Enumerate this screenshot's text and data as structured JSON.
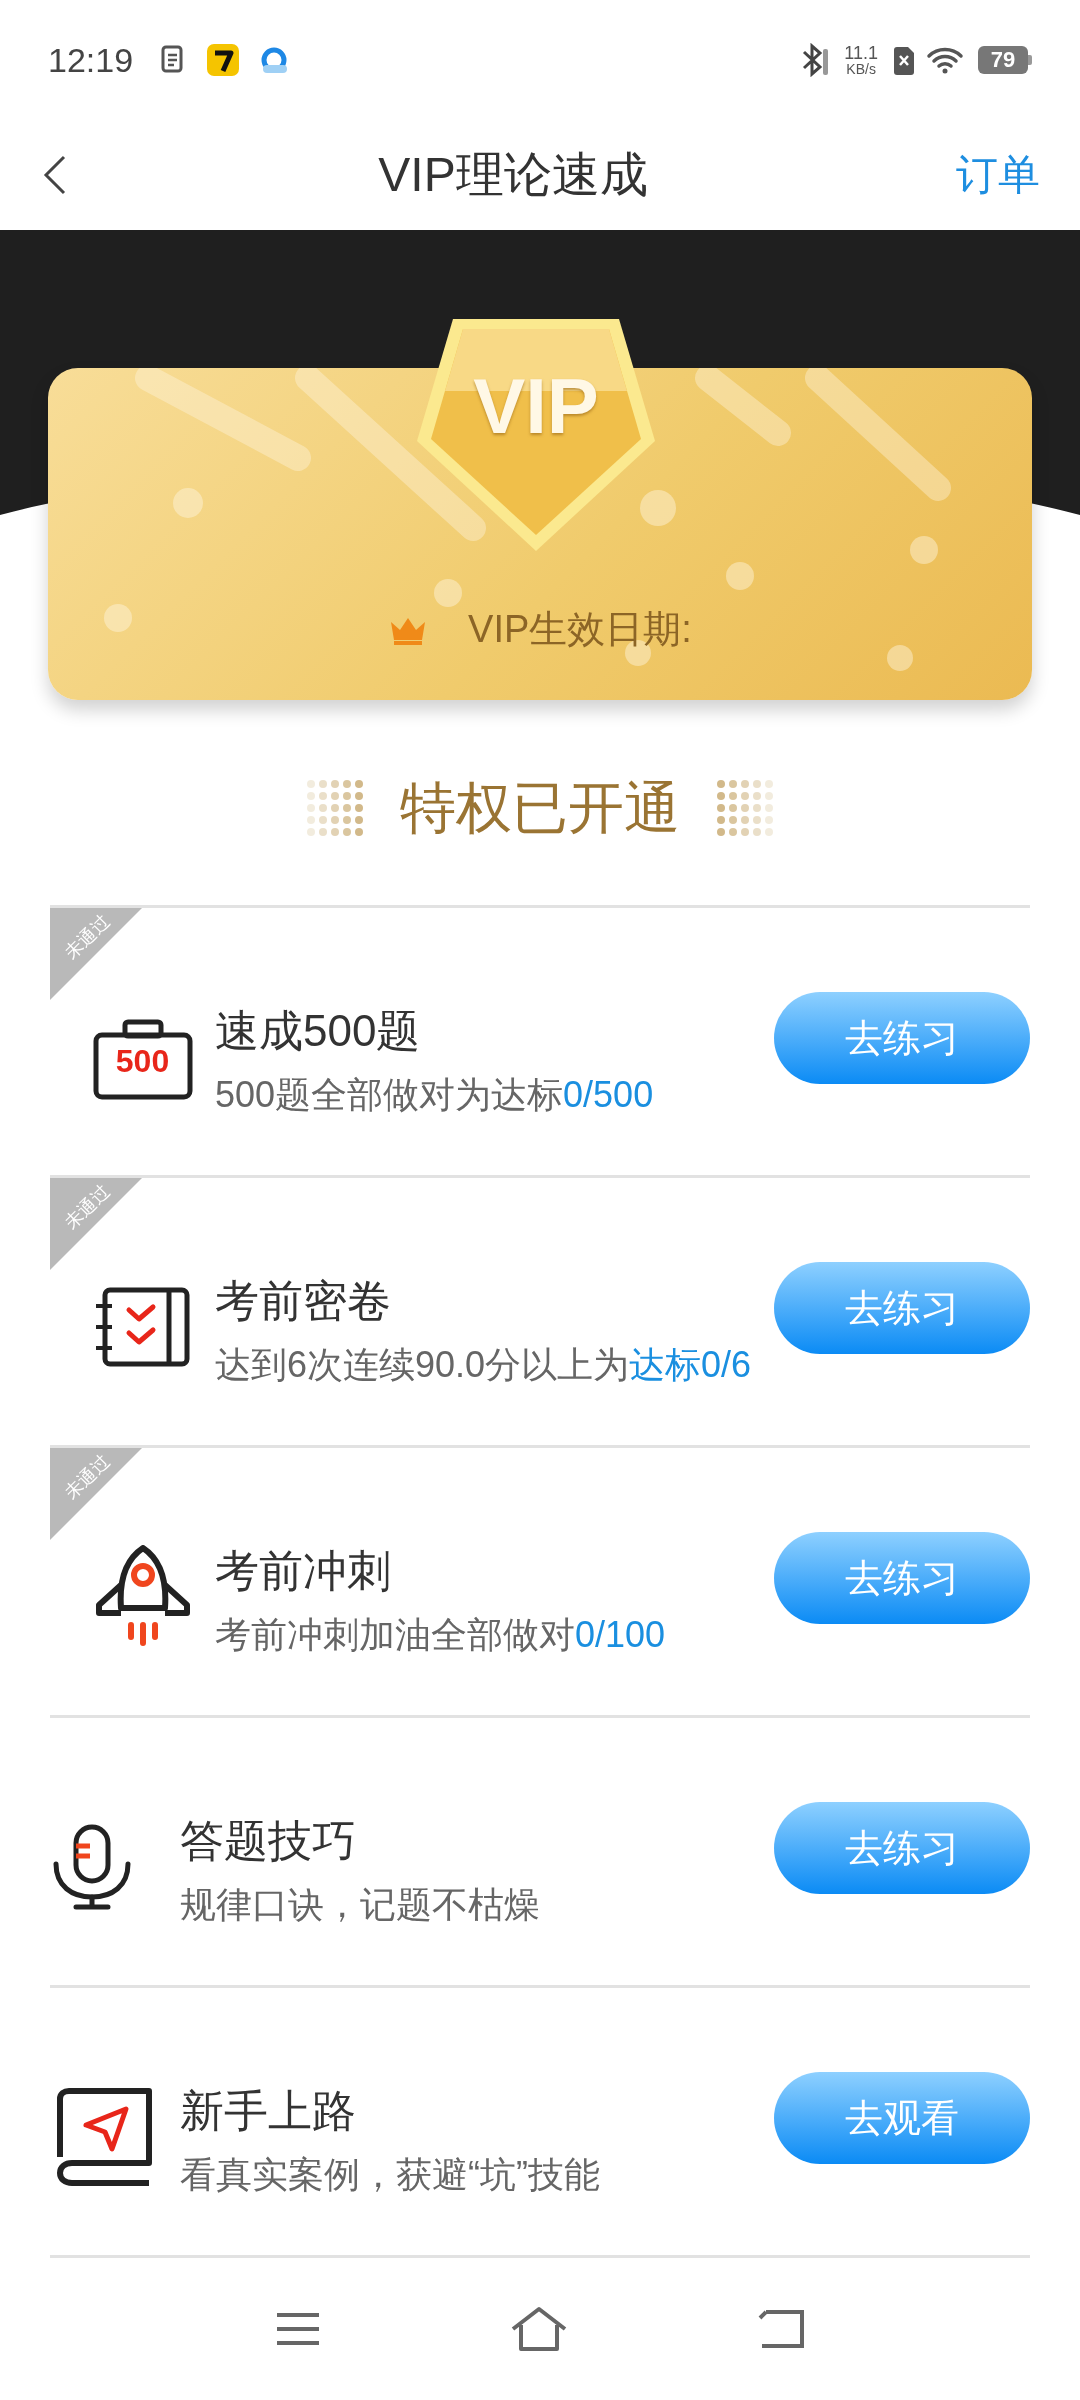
{
  "status_bar": {
    "time": "12:19",
    "speed": "11.1",
    "speed_unit": "KB/s",
    "battery": "79"
  },
  "header": {
    "title": "VIP理论速成",
    "action": "订单"
  },
  "vip_card": {
    "badge": "VIP",
    "date_label": "VIP生效日期:"
  },
  "section_title": "特权已开通",
  "items": [
    {
      "kind": "box",
      "icon_label": "500",
      "ribbon": "未通过",
      "title": "速成500题",
      "desc": "500题全部做对为达标",
      "progress": "0/500",
      "button": "去练习"
    },
    {
      "kind": "checklist",
      "ribbon": "未通过",
      "title": "考前密卷",
      "desc": "达到6次连续90.0分以上为",
      "progress": "达标0/6",
      "button": "去练习"
    },
    {
      "kind": "rocket",
      "ribbon": "未通过",
      "title": "考前冲刺",
      "desc": "考前冲刺加油全部做对",
      "progress": "0/100",
      "button": "去练习"
    },
    {
      "kind": "mic",
      "title": "答题技巧",
      "desc": "规律口诀，记题不枯燥",
      "button": "去练习"
    },
    {
      "kind": "book",
      "title": "新手上路",
      "desc": "看真实案例，获避“坑”技能",
      "button": "去观看"
    }
  ]
}
